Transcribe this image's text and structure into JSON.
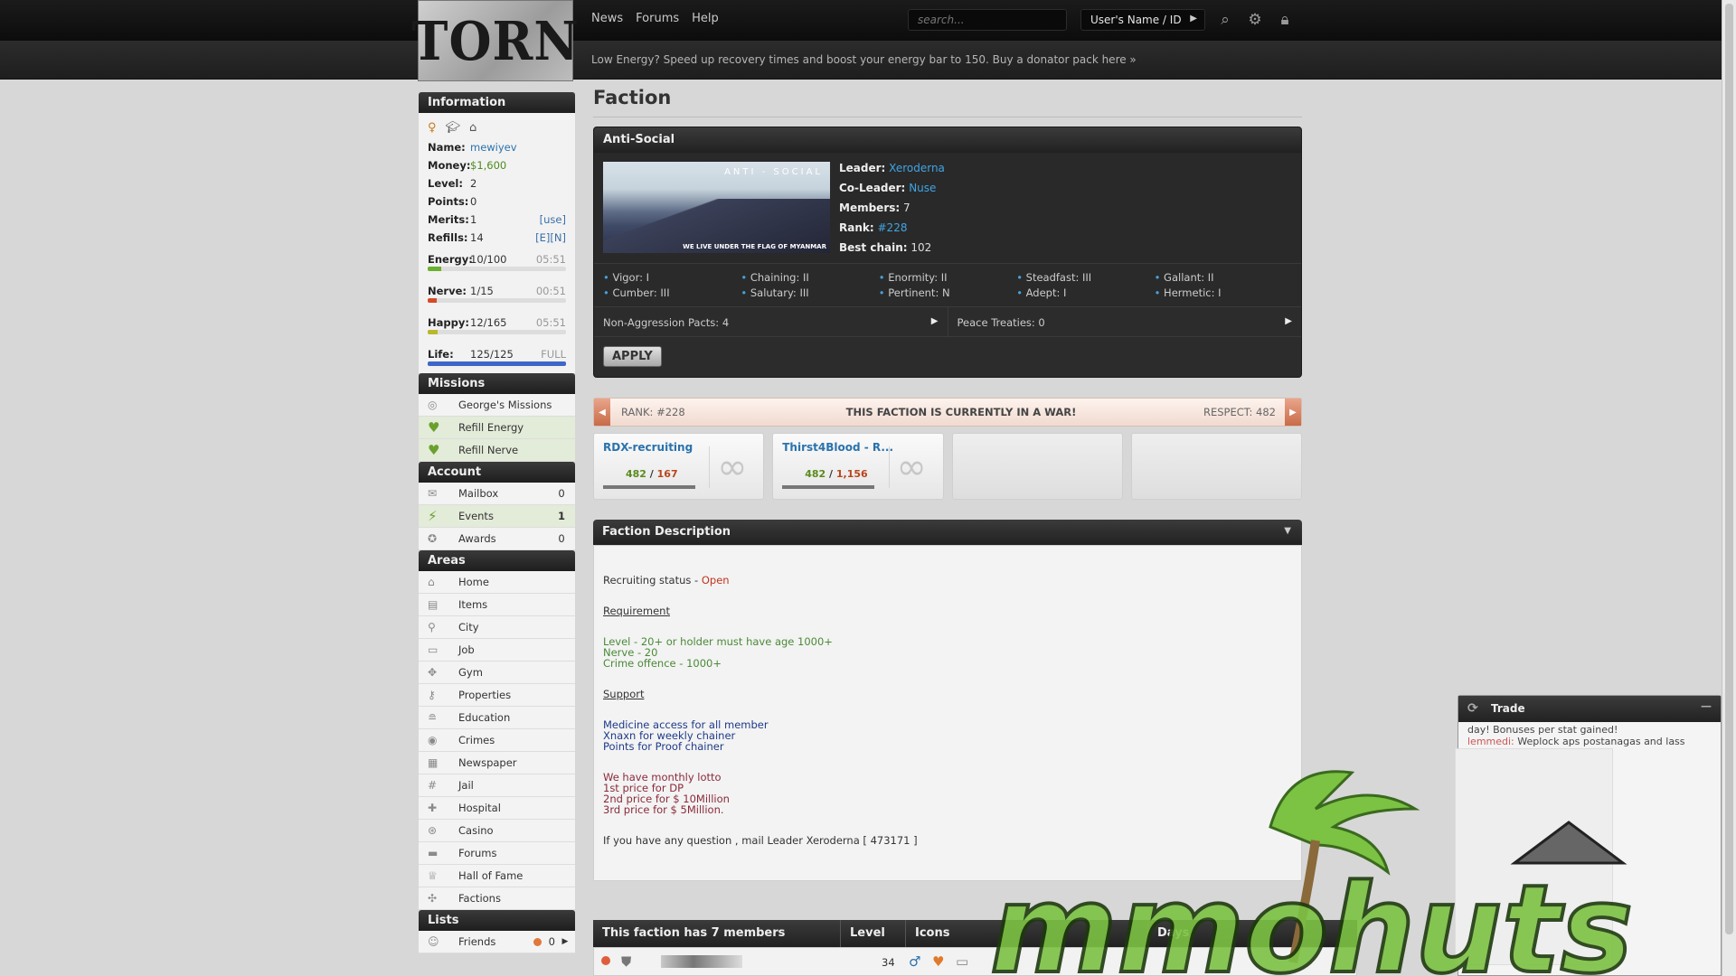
{
  "header": {
    "logo": "TORN",
    "nav": [
      "News",
      "Forums",
      "Help"
    ],
    "search_placeholder": "search...",
    "user_select": "User's Name / ID",
    "notice": "Low Energy? Speed up recovery times and boost your energy bar to 150. Buy a donator pack here »"
  },
  "sidebar": {
    "info": {
      "title": "Information",
      "name_label": "Name:",
      "name": "mewiyev",
      "money_label": "Money:",
      "money": "$1,600",
      "level_label": "Level:",
      "level": "2",
      "points_label": "Points:",
      "points": "0",
      "merits_label": "Merits:",
      "merits": "1",
      "merits_extra": "[use]",
      "refills_label": "Refills:",
      "refills": "14",
      "refills_extra": "[E][N]",
      "energy_label": "Energy:",
      "energy": "10/100",
      "energy_time": "05:51",
      "energy_fill": 0.1,
      "energy_color": "#6bb02f",
      "nerve_label": "Nerve:",
      "nerve": "1/15",
      "nerve_time": "00:51",
      "nerve_fill": 0.067,
      "nerve_color": "#d84a26",
      "happy_label": "Happy:",
      "happy": "12/165",
      "happy_time": "05:51",
      "happy_fill": 0.073,
      "happy_color": "#b9b82c",
      "life_label": "Life:",
      "life": "125/125",
      "life_time": "FULL",
      "life_fill": 1.0,
      "life_color": "#3e67c9"
    },
    "missions_title": "Missions",
    "missions": [
      {
        "label": "George's Missions",
        "icon": "target-icon"
      },
      {
        "label": "Refill Energy",
        "icon": "heart-icon"
      },
      {
        "label": "Refill Nerve",
        "icon": "heart-icon"
      }
    ],
    "account_title": "Account",
    "account": [
      {
        "label": "Mailbox",
        "count": "0",
        "icon": "mail-icon"
      },
      {
        "label": "Events",
        "count": "1",
        "icon": "lightning-icon"
      },
      {
        "label": "Awards",
        "count": "0",
        "icon": "award-icon"
      }
    ],
    "areas_title": "Areas",
    "areas": [
      "Home",
      "Items",
      "City",
      "Job",
      "Gym",
      "Properties",
      "Education",
      "Crimes",
      "Newspaper",
      "Jail",
      "Hospital",
      "Casino",
      "Forums",
      "Hall of Fame",
      "Factions"
    ],
    "lists_title": "Lists",
    "lists": [
      {
        "label": "Friends",
        "count": "0"
      }
    ]
  },
  "main": {
    "title": "Faction",
    "faction": {
      "name": "Anti-Social",
      "banner_title": "ANTI - SOCIAL",
      "banner_sub": "WE LIVE UNDER THE FLAG OF MYANMAR",
      "leader_label": "Leader:",
      "leader": "Xeroderna",
      "coleader_label": "Co-Leader:",
      "coleader": "Nuse",
      "members_label": "Members:",
      "members": "7",
      "rank_label": "Rank:",
      "rank": "#228",
      "chain_label": "Best chain:",
      "chain": "102",
      "perks": [
        "Vigor: I",
        "Chaining: II",
        "Enormity: II",
        "Steadfast: III",
        "Gallant: II",
        "Cumber: III",
        "Salutary: III",
        "Pertinent: N",
        "Adept: I",
        "Hermetic: I"
      ],
      "pacts": "Non-Aggression Pacts: 4",
      "treaties": "Peace Treaties: 0",
      "apply": "APPLY"
    },
    "war": {
      "rank": "RANK: #228",
      "message": "THIS FACTION IS CURRENTLY IN A WAR!",
      "respect": "RESPECT: 482"
    },
    "wars": [
      {
        "name": "RDX-recruiting",
        "a": "482",
        "b": "167"
      },
      {
        "name": "Thirst4Blood - R...",
        "a": "482",
        "b": "1,156"
      }
    ],
    "description": {
      "title": "Faction Description",
      "recruiting": "Recruiting status - ",
      "recruiting_value": "Open",
      "req_title": "Requirement",
      "req": [
        "Level - 20+ or holder must have age 1000+",
        "Nerve - 20",
        "Crime offence - 1000+"
      ],
      "support_title": "Support",
      "support": [
        "Medicine access for all member",
        "Xnaxn for weekly chainer",
        "Points for Proof chainer"
      ],
      "lotto": [
        "We have monthly lotto",
        "1st price for DP",
        "2nd price for $ 10Million",
        "3rd price for $ 5Million."
      ],
      "footer": "If you have any question , mail Leader Xeroderna [ 473171 ]"
    },
    "members_table": {
      "title": "This faction has 7 members",
      "col_level": "Level",
      "col_icons": "Icons",
      "col_days": "Days",
      "row_level": "34"
    }
  },
  "trade": {
    "title": "Trade",
    "line1": "day! Bonuses per stat gained!",
    "line2_user": "lemmedi:",
    "line2": " Weplock aps postanagas and lass"
  },
  "watermark": "mmohuts"
}
